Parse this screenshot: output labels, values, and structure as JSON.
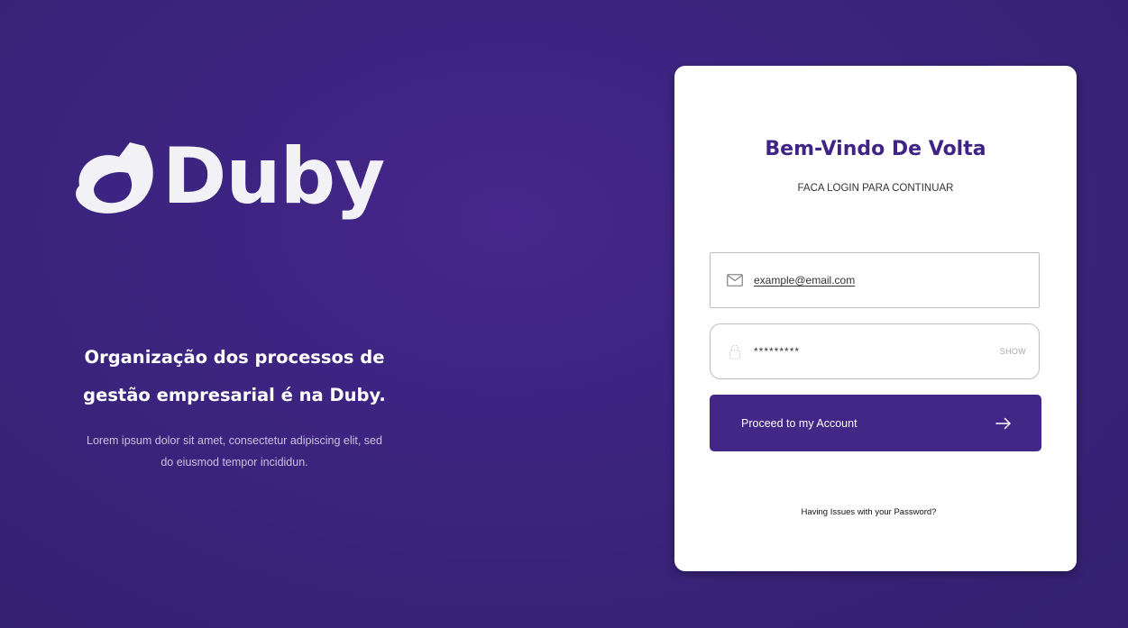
{
  "brand": {
    "name": "Duby",
    "logo_icon": "duby-logo-mark-icon"
  },
  "hero": {
    "headline_line1": "Organização dos processos de",
    "headline_line2": "gestão empresarial é na Duby.",
    "description": "Lorem ipsum dolor sit amet, consectetur adipiscing elit, sed do eiusmod tempor incididun."
  },
  "login": {
    "title": "Bem-Vindo De Volta",
    "subtitle": "FACA LOGIN PARA CONTINUAR",
    "email": {
      "value": "example@email.com",
      "icon": "mail-icon"
    },
    "password": {
      "value": "*********",
      "icon": "lock-icon",
      "toggle_label": "SHOW"
    },
    "submit": {
      "label": "Proceed to my Account",
      "icon": "arrow-right-icon"
    },
    "help_link": "Having Issues with your Password?"
  },
  "colors": {
    "background": "#3c2480",
    "accent": "#432786",
    "title": "#3f2486",
    "card": "#ffffff"
  }
}
